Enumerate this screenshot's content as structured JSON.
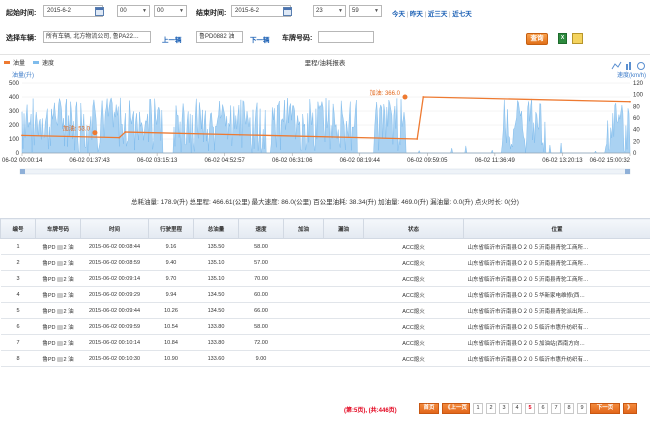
{
  "filters": {
    "start_label": "起始时间:",
    "start_date": "2015-6-2",
    "start_hour": "00",
    "start_min": "00",
    "end_label": "结束时间:",
    "end_date": "2015-6-2",
    "end_hour": "23",
    "end_min": "59",
    "quick": [
      "今天",
      "昨天",
      "近三天",
      "近七天"
    ],
    "vehicle_label": "选择车辆:",
    "vehicle_value": "所有车辆, 北方物流公司, 鲁PA22…",
    "prev_vehicle": "上一辆",
    "current_vehicle": "鲁PD0882 油",
    "next_vehicle": "下一辆",
    "plate_label": "车牌号码:",
    "plate_value": "",
    "query_button": "查询"
  },
  "chart_data": {
    "type": "area",
    "title": "里程/油耗报表",
    "legend": [
      "油量",
      "速度"
    ],
    "ylabel_left": "油量(升)",
    "ylabel_right": "速度(km/h)",
    "yticks_left": [
      "500",
      "400",
      "300",
      "200",
      "100",
      "0"
    ],
    "yticks_right": [
      "120",
      "100",
      "80",
      "60",
      "40",
      "20",
      "0"
    ],
    "ylim_left": [
      0,
      500
    ],
    "ylim_right": [
      0,
      120
    ],
    "xticks": [
      "06-02 00:00:14",
      "06-02 01:37:43",
      "06-02 03:15:13",
      "06-02 04:52:57",
      "06-02 06:31:06",
      "06-02 08:19:44",
      "06-02 09:59:05",
      "06-02 11:36:49",
      "06-02 13:20:13",
      "06-02 15:00:32"
    ],
    "series": [
      {
        "name": "油量",
        "color": "#ee7a31",
        "x": [
          0,
          0.16,
          0.17,
          0.65,
          0.66,
          1.0
        ],
        "y": [
          126,
          110,
          150,
          100,
          400,
          366
        ]
      },
      {
        "name": "速度",
        "color": "#7fbcec"
      }
    ],
    "annotations": [
      {
        "text": "加油: 53.0",
        "x": 0.115,
        "y": 145
      },
      {
        "text": "加油: 366.0",
        "x": 0.625,
        "y": 400
      }
    ]
  },
  "summary": "总耗油量: 178.9(升)  总里程: 466.61(公里)  最大速度: 86.0(公里)  百公里油耗: 38.34(升)  加油量: 469.0(升)  漏油量: 0.0(升)  点火时长: 0(分)",
  "table": {
    "headers": [
      "编号",
      "车牌号码",
      "时间",
      "行驶里程",
      "总油量",
      "速度",
      "加油",
      "漏油",
      "状态",
      "位置"
    ],
    "rows": [
      {
        "no": "1",
        "plate_a": "鲁PD",
        "plate_b": "2 油",
        "time": "2015-06-02 00:08:44",
        "mileage": "9.16",
        "fuel": "135.50",
        "speed": "58.00",
        "add": "",
        "leak": "",
        "status": "ACC熄火",
        "loc": "山东省临沂市沂南县Ｏ２０５沂南县青驼工商所…"
      },
      {
        "no": "2",
        "plate_a": "鲁PD",
        "plate_b": "2 油",
        "time": "2015-06-02 00:08:59",
        "mileage": "9.40",
        "fuel": "135.10",
        "speed": "57.00",
        "add": "",
        "leak": "",
        "status": "ACC熄火",
        "loc": "山东省临沂市沂南县Ｏ２０５沂南县青驼工商所…"
      },
      {
        "no": "3",
        "plate_a": "鲁PD",
        "plate_b": "2 油",
        "time": "2015-06-02 00:09:14",
        "mileage": "9.70",
        "fuel": "135.10",
        "speed": "70.00",
        "add": "",
        "leak": "",
        "status": "ACC熄火",
        "loc": "山东省临沂市沂南县Ｏ２０５沂南县青驼工商所…"
      },
      {
        "no": "4",
        "plate_a": "鲁PD",
        "plate_b": "2 油",
        "time": "2015-06-02 00:09:29",
        "mileage": "9.94",
        "fuel": "134.50",
        "speed": "60.00",
        "add": "",
        "leak": "",
        "status": "ACC熄火",
        "loc": "山东省临沂市沂南县Ｏ２０５华新家电维修(西…"
      },
      {
        "no": "5",
        "plate_a": "鲁PD",
        "plate_b": "2 油",
        "time": "2015-06-02 00:09:44",
        "mileage": "10.26",
        "fuel": "134.50",
        "speed": "66.00",
        "add": "",
        "leak": "",
        "status": "ACC熄火",
        "loc": "山东省临沂市沂南县Ｏ２０５沂南县青驼派出所…"
      },
      {
        "no": "6",
        "plate_a": "鲁PD",
        "plate_b": "2 油",
        "time": "2015-06-02 00:09:59",
        "mileage": "10.54",
        "fuel": "133.80",
        "speed": "58.00",
        "add": "",
        "leak": "",
        "status": "ACC熄火",
        "loc": "山东省临沂市沂南县Ｏ２０５临沂市惠升纺织有…"
      },
      {
        "no": "7",
        "plate_a": "鲁PD",
        "plate_b": "2 油",
        "time": "2015-06-02 00:10:14",
        "mileage": "10.84",
        "fuel": "133.80",
        "speed": "72.00",
        "add": "",
        "leak": "",
        "status": "ACC熄火",
        "loc": "山东省临沂市沂南县Ｏ２０５加油站(西南方向…"
      },
      {
        "no": "8",
        "plate_a": "鲁PD",
        "plate_b": "2 油",
        "time": "2015-06-02 00:10:30",
        "mileage": "10.90",
        "fuel": "133.60",
        "speed": "9.00",
        "add": "",
        "leak": "",
        "status": "ACC熄火",
        "loc": "山东省临沂市沂南县Ｏ２０５临沂市惠升纺织有…"
      }
    ]
  },
  "pagination": {
    "info": "(第:5页), (共:446页)",
    "first": "首页",
    "prev": "《上一页",
    "pages": [
      "1",
      "2",
      "3",
      "4",
      "5",
      "6",
      "7",
      "8",
      "9"
    ],
    "current": "5",
    "next": "下一页",
    "last": "》"
  }
}
